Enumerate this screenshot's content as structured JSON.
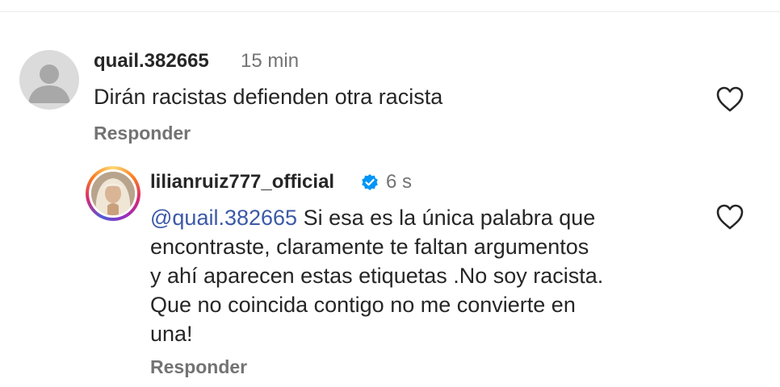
{
  "comments": [
    {
      "username": "quail.382665",
      "time": "15 min",
      "text": "Dirán racistas defienden otra racista",
      "reply_label": "Responder",
      "like_icon": "heart-outline-icon",
      "avatar_icon": "default-user-avatar-icon"
    },
    {
      "username": "lilianruiz777_official",
      "verified": true,
      "verified_icon": "verified-badge-icon",
      "verified_color": "#0095f6",
      "time": "6 s",
      "mention": "@quail.382665",
      "text_line1": " Si esa es la única palabra que",
      "text_line2": "encontraste, claramente te faltan argumentos",
      "text_line3": "y ahí aparecen estas etiquetas .No soy racista.",
      "text_line4": "Que no coincida contigo no me convierte en",
      "text_line5": "una!",
      "reply_label": "Responder",
      "like_icon": "heart-outline-icon"
    }
  ],
  "colors": {
    "mention": "#3c59a8",
    "secondary_text": "#737373",
    "primary_text": "#262626"
  }
}
